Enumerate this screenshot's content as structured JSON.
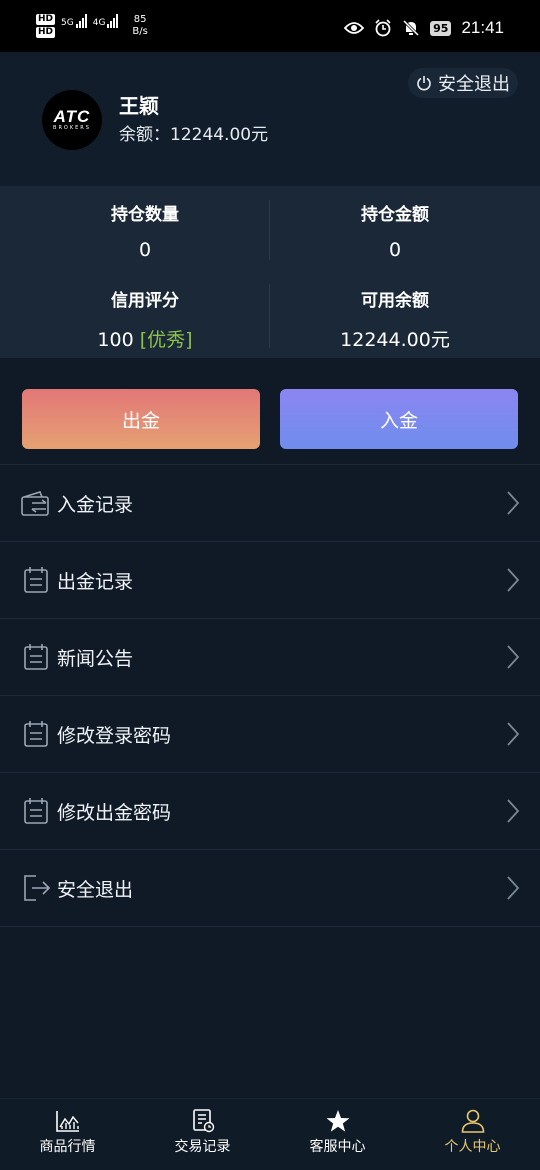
{
  "status_bar": {
    "hd_badge_1": "HD",
    "hd_badge_2": "HD",
    "network_1": "5G",
    "network_2": "4G",
    "speed_value": "85",
    "speed_unit": "B/s",
    "battery": "95",
    "time": "21:41",
    "icons": [
      "eye-icon",
      "alarm-icon",
      "mute-bell-icon",
      "battery-icon"
    ]
  },
  "header": {
    "logout_label": "安全退出",
    "avatar_logo": "ATC",
    "avatar_logo_sub": "BROKERS",
    "user_name": "王颖",
    "balance_label": "余额：",
    "balance_value": "12244.00元"
  },
  "stats": {
    "position_count_label": "持仓数量",
    "position_count_value": "0",
    "position_amount_label": "持仓金额",
    "position_amount_value": "0",
    "credit_label": "信用评分",
    "credit_value": "100",
    "credit_level": "[优秀]",
    "available_label": "可用余额",
    "available_value": "12244.00元"
  },
  "actions": {
    "withdraw_label": "出金",
    "deposit_label": "入金"
  },
  "menu": [
    {
      "label": "入金记录",
      "icon": "wallet-icon"
    },
    {
      "label": "出金记录",
      "icon": "calendar-list-icon"
    },
    {
      "label": "新闻公告",
      "icon": "calendar-list-icon"
    },
    {
      "label": "修改登录密码",
      "icon": "calendar-list-icon"
    },
    {
      "label": "修改出金密码",
      "icon": "calendar-list-icon"
    },
    {
      "label": "安全退出",
      "icon": "exit-icon"
    }
  ],
  "tabbar": [
    {
      "label": "商品行情",
      "icon": "chart-icon",
      "active": false
    },
    {
      "label": "交易记录",
      "icon": "document-icon",
      "active": false
    },
    {
      "label": "客服中心",
      "icon": "star-icon",
      "active": false
    },
    {
      "label": "个人中心",
      "icon": "user-icon",
      "active": true
    }
  ],
  "colors": {
    "background": "#0f1a26",
    "stats_background": "#1b2838",
    "active_tab": "#e8c86e",
    "credit_level": "#8bc34a"
  }
}
